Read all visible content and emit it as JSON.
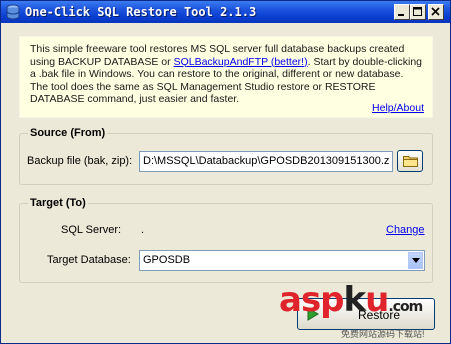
{
  "window": {
    "title": "One-Click SQL Restore Tool 2.1.3"
  },
  "info": {
    "text_1": "This simple freeware tool restores MS SQL server full database backups created using BACKUP DATABASE or ",
    "link_text": "SQLBackupAndFTP (better!)",
    "text_2": ". Start by double-clicking a .bak file in Windows. You can restore to the original, different or new database. The tool does the same as SQL Management Studio restore or RESTORE DATABASE command, just easier and faster.",
    "help_link": "Help/About"
  },
  "source": {
    "title": "Source (From)",
    "backup_label": "Backup file (bak, zip):",
    "backup_value": "D:\\MSSQL\\Databackup\\GPOSDB201309151300.z"
  },
  "target": {
    "title": "Target (To)",
    "server_label": "SQL Server:",
    "server_value": ".",
    "change_link": "Change",
    "database_label": "Target Database:",
    "database_value": "GPOSDB"
  },
  "actions": {
    "restore_label": "Restore"
  },
  "watermark": {
    "part_a": "asp",
    "part_b": "k",
    "part_c": "u",
    "part_d": ".com",
    "subtitle": "免费网站源码下载站!"
  },
  "colors": {
    "title_bar": "#0a3fd0",
    "info_background": "#ffffe1",
    "link": "#0000ee",
    "watermark_red": "#e0242b"
  },
  "icons": {
    "app": "database-restore-icon",
    "browse": "folder-icon",
    "restore": "play-icon"
  }
}
